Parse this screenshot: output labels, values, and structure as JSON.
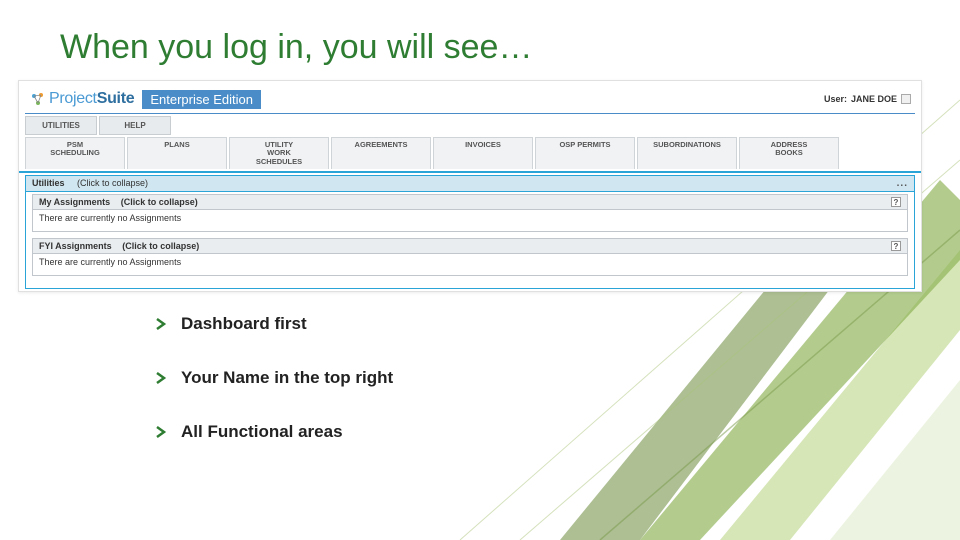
{
  "slide": {
    "title": "When you log in, you will see…",
    "bullets": [
      "Dashboard first",
      "Your Name in the top right",
      "All Functional areas"
    ]
  },
  "app": {
    "logo_prefix": "Project",
    "logo_suffix": "Suite",
    "edition": "Enterprise Edition",
    "user_label": "User:",
    "user_name": "JANE DOE"
  },
  "menu": {
    "items": [
      "UTILITIES",
      "HELP"
    ]
  },
  "subtabs": {
    "items": [
      "PSM\nSCHEDULING",
      "PLANS",
      "UTILITY\nWORK\nSCHEDULES",
      "AGREEMENTS",
      "INVOICES",
      "OSP PERMITS",
      "SUBORDINATIONS",
      "ADDRESS\nBOOKS"
    ]
  },
  "panel": {
    "title": "Utilities",
    "hint": "(Click to collapse)",
    "dots": "..."
  },
  "sub1": {
    "title": "My Assignments",
    "hint": "(Click to collapse)",
    "body": "There are currently no Assignments",
    "icon": "?"
  },
  "sub2": {
    "title": "FYI Assignments",
    "hint": "(Click to collapse)",
    "body": "There are currently no Assignments",
    "icon": "?"
  },
  "colors": {
    "green": "#2e7d32",
    "dark_green": "#6a8a3a",
    "light_green": "#b8d078"
  }
}
